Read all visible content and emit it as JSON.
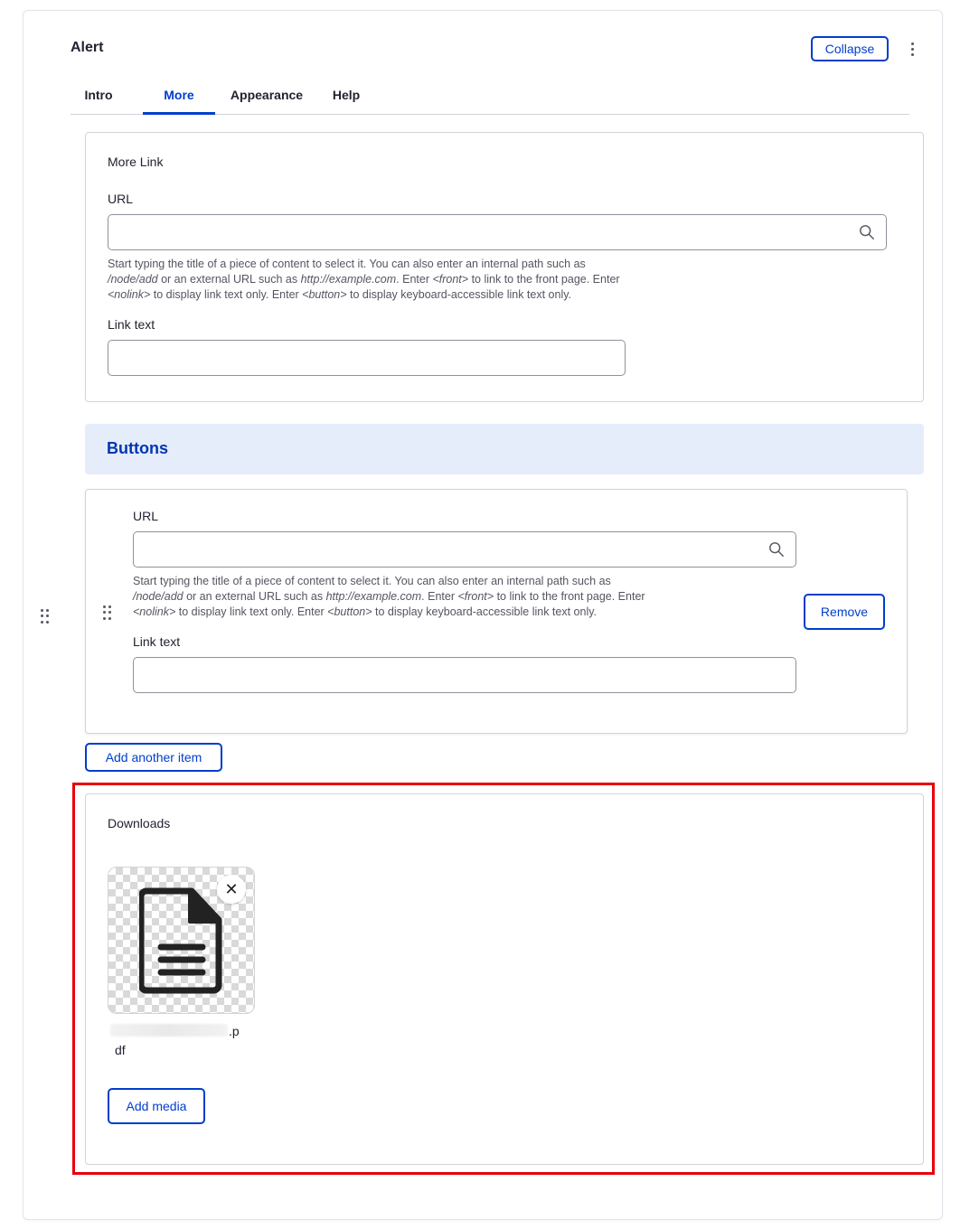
{
  "header": {
    "title": "Alert",
    "collapse_label": "Collapse",
    "menu_icon": "kebab-icon"
  },
  "tabs": [
    {
      "label": "Intro",
      "active": false
    },
    {
      "label": "More",
      "active": true
    },
    {
      "label": "Appearance",
      "active": false
    },
    {
      "label": "Help",
      "active": false
    }
  ],
  "more_link": {
    "title": "More Link",
    "url_label": "URL",
    "url_value": "",
    "desc": {
      "p1": "Start typing the title of a piece of content to select it. You can also enter an internal path such as",
      "path": "/node/add",
      "p2": " or an external URL such as ",
      "ext": "http://example.com",
      "p3": ". Enter ",
      "front": "<front>",
      "p4": " to link to the front page. Enter",
      "nolink": "<nolink>",
      "p5": " to display link text only. Enter ",
      "button": "<button>",
      "p6": " to display keyboard-accessible link text only."
    },
    "link_text_label": "Link text",
    "link_text_value": ""
  },
  "buttons": {
    "title": "Buttons",
    "item": {
      "url_label": "URL",
      "url_value": "",
      "link_text_label": "Link text",
      "link_text_value": "",
      "remove_label": "Remove"
    },
    "add_label": "Add another item"
  },
  "downloads": {
    "title": "Downloads",
    "file_ext_line1": ".p",
    "file_ext_line2": "df",
    "remove_icon": "close-icon",
    "file_icon": "document-icon",
    "add_media_label": "Add media"
  },
  "colors": {
    "accent": "#003ecc",
    "highlight": "#e8000a",
    "section_bg": "#e5ecfa"
  }
}
